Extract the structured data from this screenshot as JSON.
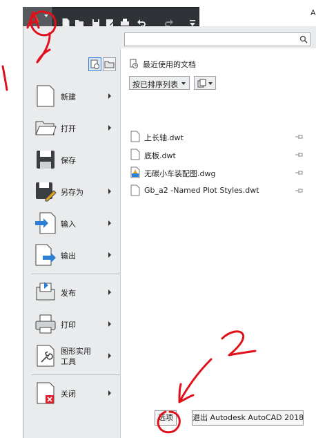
{
  "window": {
    "title_fragment": "A"
  },
  "app_button": {
    "icon": "autocad-a-logo"
  },
  "quick_access": {
    "icons": [
      "new-file-icon",
      "open-folder-icon",
      "save-icon",
      "save-as-icon",
      "print-icon",
      "undo-icon",
      "redo-icon",
      "customize-dropdown-icon"
    ]
  },
  "search": {
    "value": "",
    "placeholder": ""
  },
  "view_toggle": {
    "icons": [
      "recent-documents-icon",
      "open-documents-icon"
    ]
  },
  "commands": [
    {
      "label": "新建",
      "icon": "new-file-icon",
      "has_submenu": true
    },
    {
      "label": "打开",
      "icon": "open-folder-icon",
      "has_submenu": true
    },
    {
      "label": "保存",
      "icon": "save-icon",
      "has_submenu": false
    },
    {
      "label": "另存为",
      "icon": "save-as-icon",
      "has_submenu": true
    },
    {
      "label": "输入",
      "icon": "import-icon",
      "has_submenu": true
    },
    {
      "label": "输出",
      "icon": "export-icon",
      "has_submenu": true
    },
    {
      "label": "发布",
      "icon": "publish-icon",
      "has_submenu": true
    },
    {
      "label": "打印",
      "icon": "print-icon",
      "has_submenu": true
    },
    {
      "label": "图形实用\n工具",
      "icon": "drawing-utilities-icon",
      "has_submenu": true
    },
    {
      "label": "关闭",
      "icon": "close-document-icon",
      "has_submenu": true
    }
  ],
  "recent": {
    "heading": "最近使用的文档",
    "sort_label": "按已排序列表",
    "documents": [
      {
        "name": "上长轴.dwt",
        "icon": "dwt-file-icon"
      },
      {
        "name": "底板.dwt",
        "icon": "dwt-file-icon"
      },
      {
        "name": "无碳小车装配图.dwg",
        "icon": "dwg-file-icon"
      },
      {
        "name": "Gb_a2 -Named Plot Styles.dwt",
        "icon": "dwt-file-icon"
      }
    ]
  },
  "footer": {
    "options_label": "选项",
    "exit_label": "退出 Autodesk AutoCAD 2018"
  },
  "annotations": {
    "marks": [
      "1",
      "2"
    ],
    "ink_color": "#e0101a"
  }
}
